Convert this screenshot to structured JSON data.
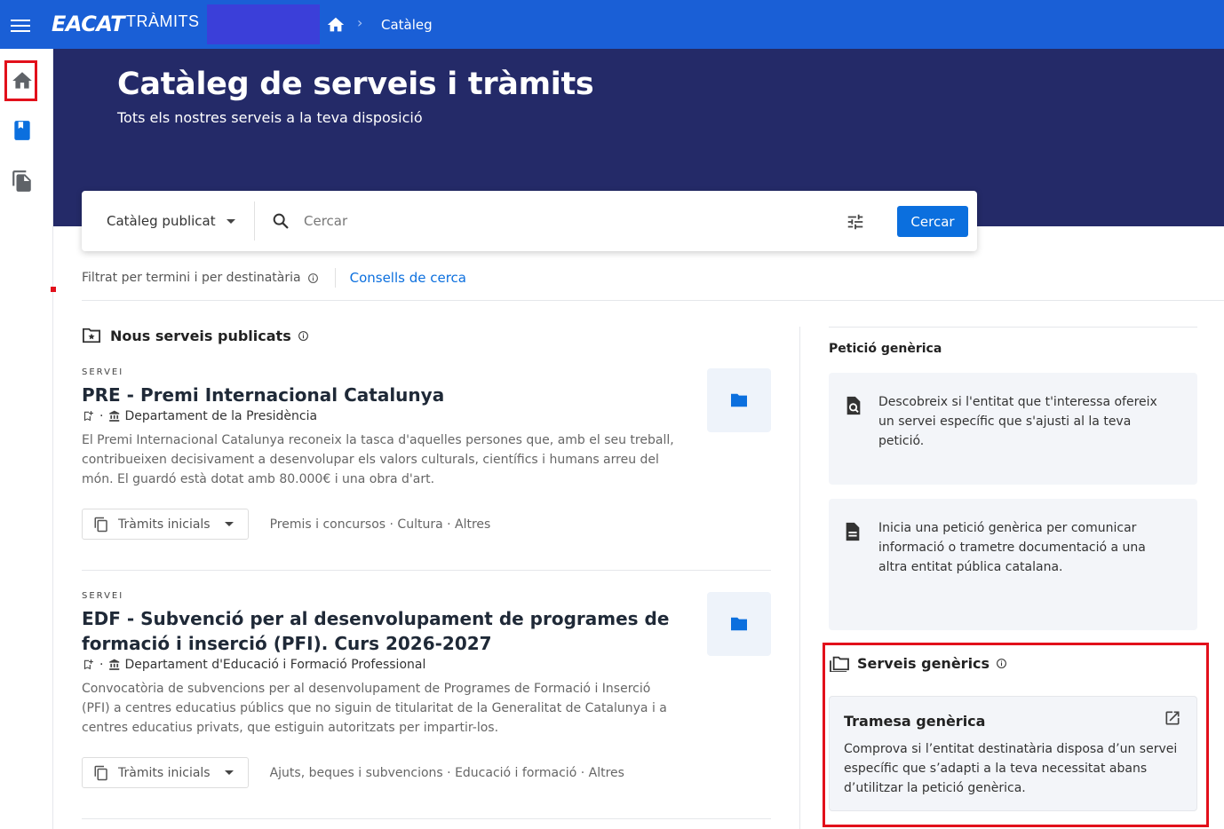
{
  "topbar": {
    "logo_main": "EACAT",
    "logo_sub": "TRÀMITS",
    "breadcrumb_current": "Catàleg"
  },
  "hero": {
    "title": "Catàleg de serveis i tràmits",
    "subtitle": "Tots els nostres serveis a la teva disposició"
  },
  "search": {
    "catalog_select": "Catàleg publicat",
    "placeholder": "Cercar",
    "button": "Cercar"
  },
  "filter_row": {
    "text": "Filtrat per termini i per destinatària",
    "tips_link": "Consells de cerca"
  },
  "new_services": {
    "heading": "Nous serveis publicats",
    "items": [
      {
        "kicker": "SERVEI",
        "title": "PRE - Premi Internacional Catalunya",
        "department": "Departament de la Presidència",
        "description": "El Premi Internacional Catalunya reconeix la tasca d'aquelles persones que, amb el seu treball, contribueixen decisivament a desenvolupar els valors culturals, científics i humans arreu del món. El guardó està dotat amb 80.000€ i una obra d'art.",
        "procedures_button": "Tràmits inicials",
        "tags": "Premis i concursos · Cultura · Altres"
      },
      {
        "kicker": "SERVEI",
        "title": "EDF - Subvenció per al desenvolupament de programes de formació i inserció (PFI). Curs 2026-2027",
        "department": "Departament d'Educació i Formació Professional",
        "description": "Convocatòria de subvencions per al desenvolupament de Programes de Formació i Inserció (PFI) a centres educatius públics que no siguin de titularitat de la Generalitat de Catalunya i a centres educatius privats, que estiguin autoritzats per impartir-los.",
        "procedures_button": "Tràmits inicials",
        "tags": "Ajuts, beques i subvencions · Educació i formació · Altres"
      }
    ]
  },
  "generic_request": {
    "title": "Petició genèrica",
    "cards": [
      {
        "icon": "document-search-icon",
        "text": "Descobreix si l'entitat que t'interessa ofereix un servei específic que s'ajusti al la teva petició."
      },
      {
        "icon": "document-icon",
        "text": "Inicia una petició genèrica per comunicar informació o trametre documentació a una altra entitat pública catalana."
      }
    ]
  },
  "generic_services": {
    "heading": "Serveis genèrics",
    "card": {
      "title": "Tramesa genèrica",
      "description": "Comprova si l’entitat destinatària disposa d’un servei específic que s’adapti a la teva necessitat abans d’utilitzar la petició genèrica."
    }
  },
  "colors": {
    "topbar": "#1a5fd6",
    "hero": "#242a68",
    "primary": "#0b6fde",
    "highlight": "#e2101b",
    "card_bg": "#f3f5f9"
  }
}
